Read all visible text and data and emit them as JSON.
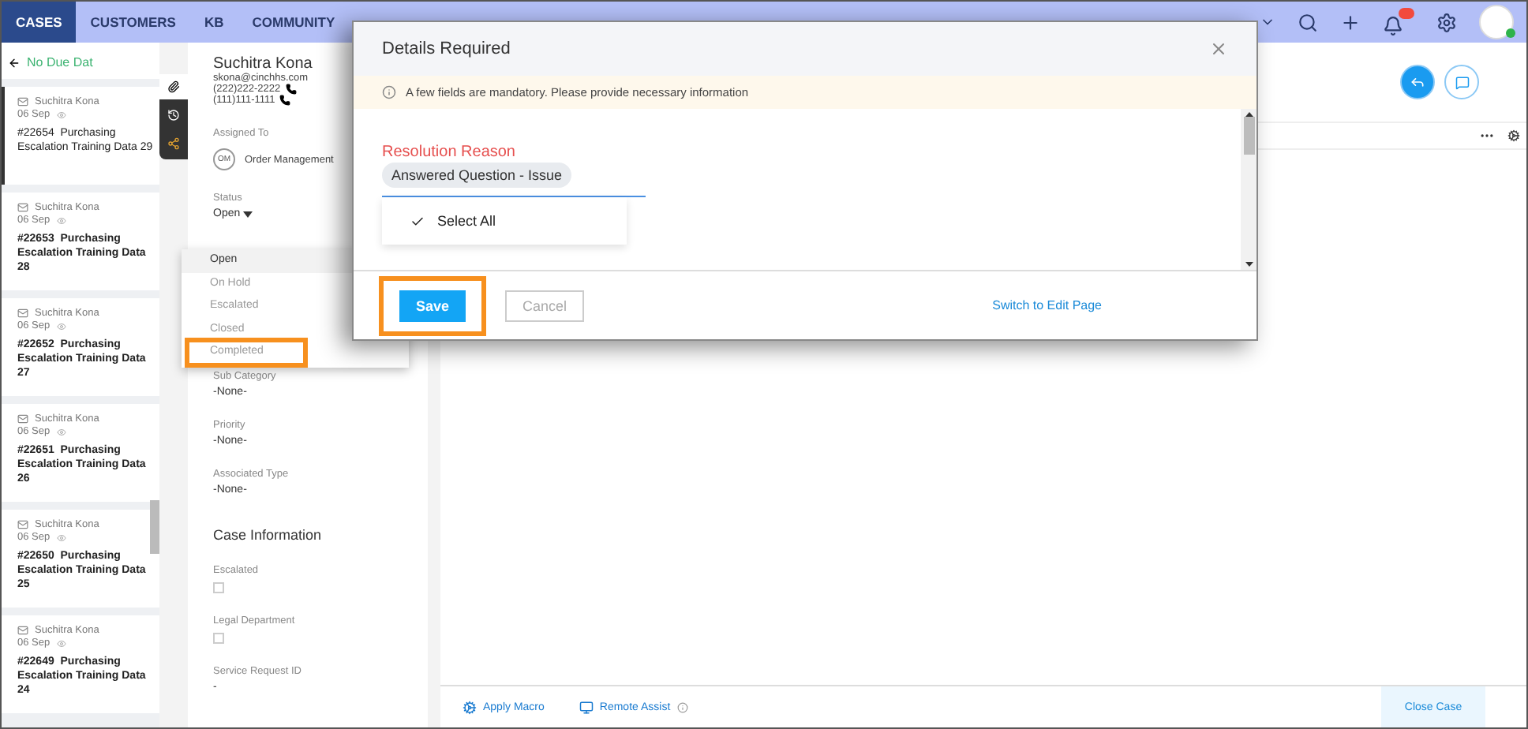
{
  "nav": {
    "tabs": [
      {
        "label": "CASES",
        "selected": true
      },
      {
        "label": "CUSTOMERS",
        "selected": false
      },
      {
        "label": "KB",
        "selected": false
      },
      {
        "label": "COMMUNITY",
        "selected": false
      }
    ]
  },
  "list": {
    "back_label": "No Due Dat",
    "tickets": [
      {
        "name": "Suchitra Kona",
        "date": "06 Sep",
        "number": "#22654",
        "title": "Purchasing Escalation Training Data 29",
        "selected": true
      },
      {
        "name": "Suchitra Kona",
        "date": "06 Sep",
        "number": "#22653",
        "title": "Purchasing Escalation Training Data 28",
        "selected": false
      },
      {
        "name": "Suchitra Kona",
        "date": "06 Sep",
        "number": "#22652",
        "title": "Purchasing Escalation Training Data 27",
        "selected": false
      },
      {
        "name": "Suchitra Kona",
        "date": "06 Sep",
        "number": "#22651",
        "title": "Purchasing Escalation Training Data 26",
        "selected": false
      },
      {
        "name": "Suchitra Kona",
        "date": "06 Sep",
        "number": "#22650",
        "title": "Purchasing Escalation Training Data 25",
        "selected": false
      },
      {
        "name": "Suchitra Kona",
        "date": "06 Sep",
        "number": "#22649",
        "title": "Purchasing Escalation Training Data 24",
        "selected": false
      }
    ]
  },
  "contact": {
    "name": "Suchitra Kona",
    "email": "skona@cinchhs.com",
    "phones": [
      "(222)222-2222",
      "(111)111-1111"
    ]
  },
  "assigned": {
    "label": "Assigned To",
    "initials": "OM",
    "team": "Order Management"
  },
  "status": {
    "label": "Status",
    "value": "Open",
    "options": [
      {
        "label": "Open",
        "selected": true,
        "highlighted": false
      },
      {
        "label": "On Hold",
        "selected": false,
        "highlighted": false
      },
      {
        "label": "Escalated",
        "selected": false,
        "highlighted": false
      },
      {
        "label": "Closed",
        "selected": false,
        "highlighted": false
      },
      {
        "label": "Completed",
        "selected": false,
        "highlighted": true
      }
    ]
  },
  "fields": [
    {
      "label": "Sub Category",
      "value": "-None-"
    },
    {
      "label": "Priority",
      "value": "-None-"
    },
    {
      "label": "Associated Type",
      "value": "-None-"
    }
  ],
  "case_information": {
    "title": "Case Information",
    "fields": [
      {
        "kind": "checkbox",
        "label": "Escalated",
        "checked": false
      },
      {
        "kind": "checkbox",
        "label": "Legal Department",
        "checked": false
      },
      {
        "kind": "text",
        "label": "Service Request ID",
        "value": "-"
      }
    ]
  },
  "bottom_bar": {
    "actions": [
      "Apply Macro",
      "Remote Assist"
    ],
    "close_button": "Close Case"
  },
  "dialog": {
    "title": "Details Required",
    "notice": "A few fields are mandatory. Please provide necessary information",
    "field_label": "Resolution Reason",
    "chip": "Answered Question - Issue",
    "option": {
      "label": "Select All",
      "checked": true
    },
    "save_button": {
      "label": "Save",
      "highlighted": true
    },
    "cancel_button": "Cancel",
    "link": "Switch to Edit Page"
  }
}
